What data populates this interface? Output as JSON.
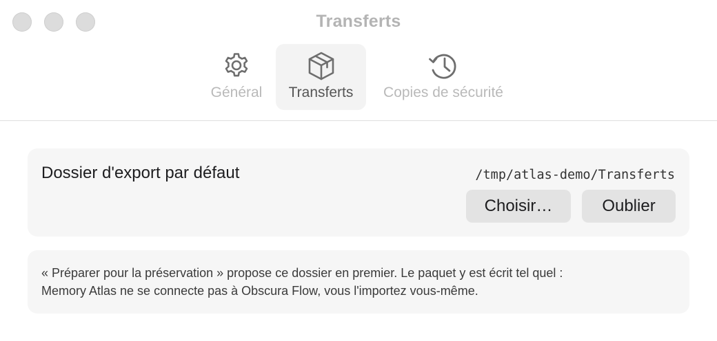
{
  "window": {
    "title": "Transferts"
  },
  "toolbar": {
    "tabs": [
      {
        "label": "Général",
        "icon": "gear-icon",
        "active": false
      },
      {
        "label": "Transferts",
        "icon": "package-icon",
        "active": true
      },
      {
        "label": "Copies de sécurité",
        "icon": "history-icon",
        "active": false
      }
    ]
  },
  "export_folder": {
    "label": "Dossier d'export par défaut",
    "path": "/tmp/atlas-demo/Transferts",
    "choose_label": "Choisir…",
    "forget_label": "Oublier"
  },
  "info": {
    "line1": "« Préparer pour la préservation » propose ce dossier en premier. Le paquet y est écrit tel quel :",
    "line2": "Memory Atlas ne se connecte pas à Obscura Flow, vous l'importez vous-même."
  },
  "colors": {
    "active_tab_bg": "#f3f3f3",
    "card_bg": "#f6f6f6",
    "button_bg": "#e3e3e3",
    "inactive_text": "#b9b9b9"
  }
}
